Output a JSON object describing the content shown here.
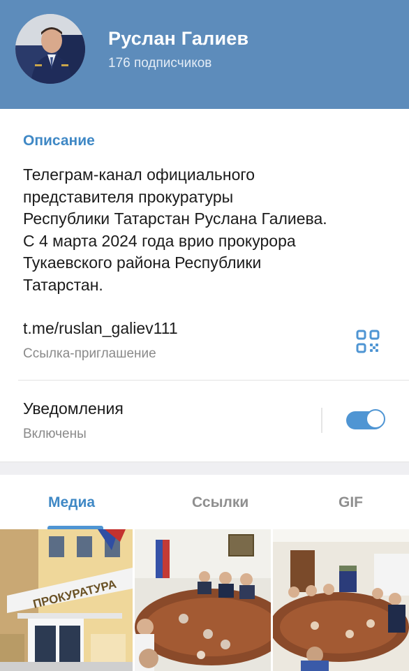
{
  "channel": {
    "name": "Руслан Галиев",
    "subscribers": "176 подписчиков"
  },
  "description": {
    "title": "Описание",
    "lines": [
      "Телеграм-канал официального",
      "представителя прокуратуры",
      "Республики Татарстан Руслана Галиева.",
      "С 4 марта 2024 года врио прокурора",
      "Тукаевского района Республики",
      "Татарстан."
    ]
  },
  "invite": {
    "link": "t.me/ruslan_galiev111",
    "label": "Ссылка-приглашение",
    "qr_icon": "qr-code-icon"
  },
  "notifications": {
    "label": "Уведомления",
    "status": "Включены",
    "enabled": true
  },
  "tabs": [
    {
      "label": "Медиа",
      "active": true
    },
    {
      "label": "Ссылки",
      "active": false
    },
    {
      "label": "GIF",
      "active": false
    }
  ],
  "media": {
    "sign_text": "ПРОКУРАТУРА"
  },
  "colors": {
    "header": "#5d8cbb",
    "accent": "#3f88c5",
    "toggle": "#4f95d3"
  }
}
